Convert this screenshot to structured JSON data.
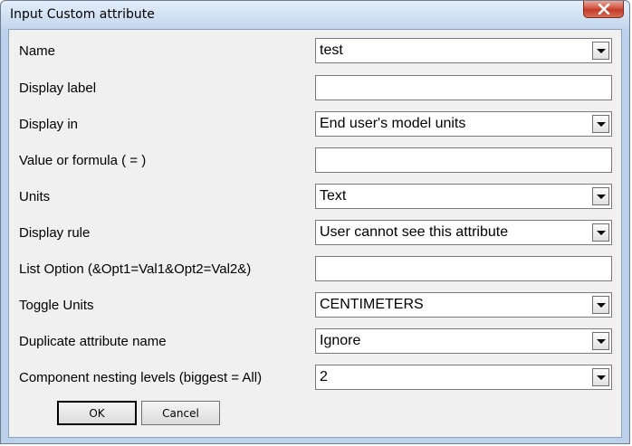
{
  "window": {
    "title": "Input Custom attribute"
  },
  "fields": [
    {
      "key": "name",
      "label": "Name",
      "type": "dropdown",
      "value": "test"
    },
    {
      "key": "display_label",
      "label": "Display label",
      "type": "text",
      "value": ""
    },
    {
      "key": "display_in",
      "label": "Display in",
      "type": "dropdown",
      "value": "End user's model units"
    },
    {
      "key": "value_formula",
      "label": "Value or formula ( = )",
      "type": "text",
      "value": ""
    },
    {
      "key": "units",
      "label": "Units",
      "type": "dropdown",
      "value": "Text"
    },
    {
      "key": "display_rule",
      "label": "Display rule",
      "type": "dropdown",
      "value": "User cannot see this attribute"
    },
    {
      "key": "list_option",
      "label": "List Option (&Opt1=Val1&Opt2=Val2&)",
      "type": "text",
      "value": ""
    },
    {
      "key": "toggle_units",
      "label": "Toggle Units",
      "type": "dropdown",
      "value": "CENTIMETERS"
    },
    {
      "key": "duplicate_name",
      "label": "Duplicate attribute name",
      "type": "dropdown",
      "value": "Ignore"
    },
    {
      "key": "nesting_levels",
      "label": "Component nesting levels (biggest = All)",
      "type": "dropdown",
      "value": "2"
    }
  ],
  "buttons": {
    "ok_label": "OK",
    "cancel_label": "Cancel"
  }
}
